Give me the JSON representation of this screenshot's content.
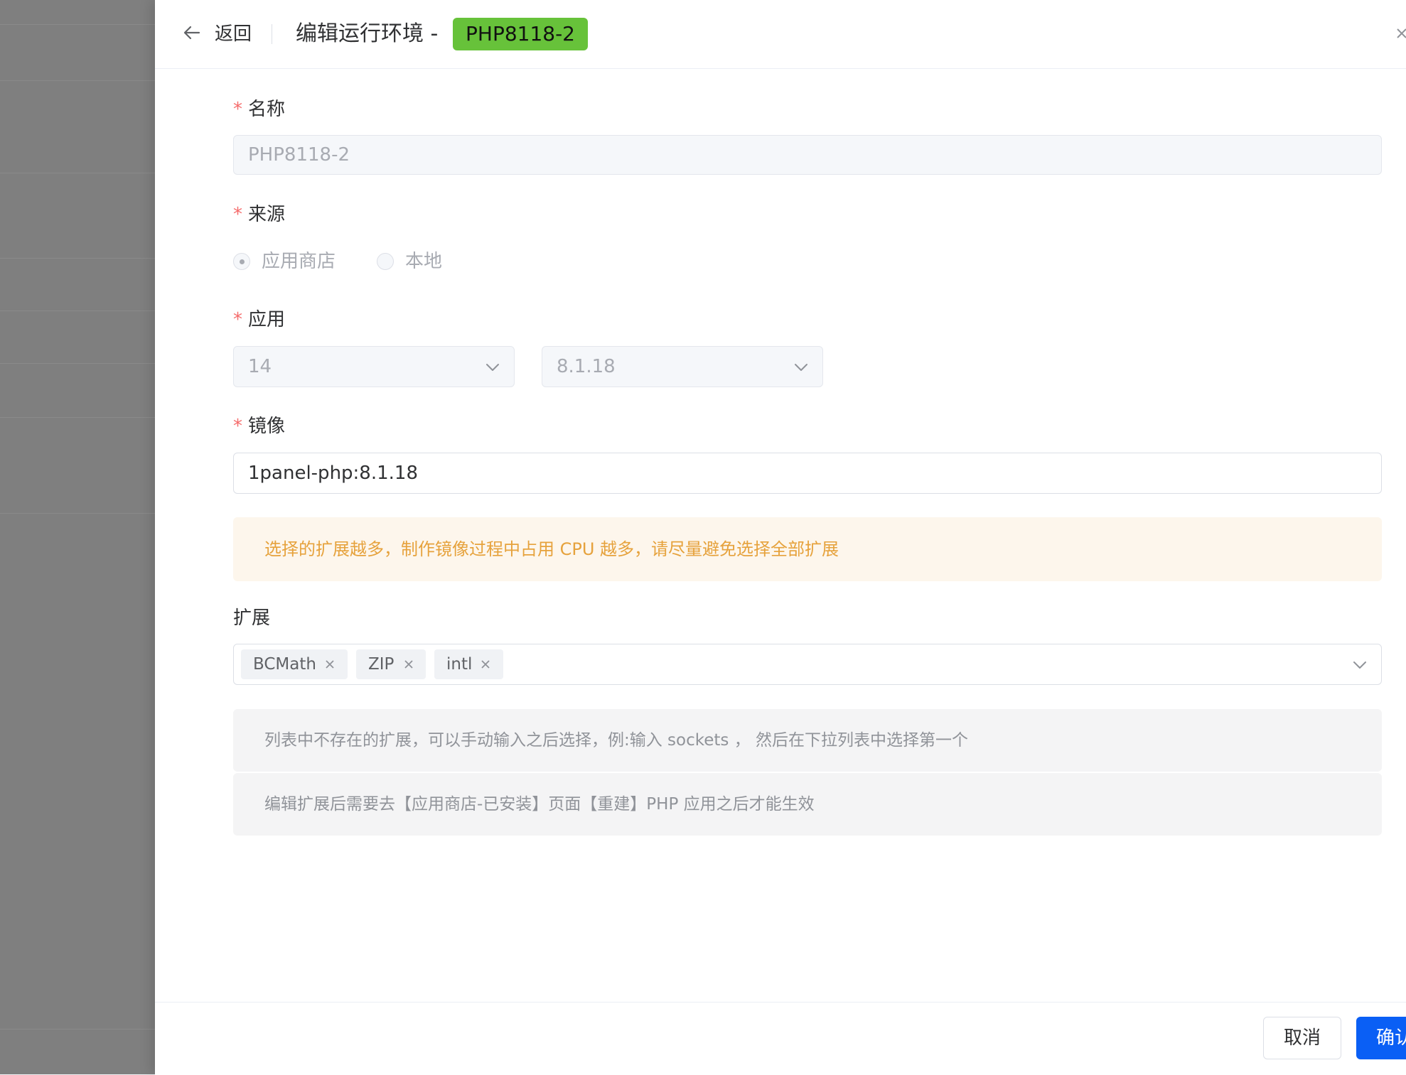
{
  "header": {
    "back_label": "返回",
    "title": "编辑运行环境 -",
    "tag": "PHP8118-2"
  },
  "form": {
    "name": {
      "label": "名称",
      "value": "PHP8118-2"
    },
    "source": {
      "label": "来源",
      "options": [
        "应用商店",
        "本地"
      ],
      "selected": "应用商店"
    },
    "app": {
      "label": "应用",
      "app_select": "14",
      "version_select": "8.1.18"
    },
    "image": {
      "label": "镜像",
      "value": "1panel-php:8.1.18"
    },
    "alert": "选择的扩展越多，制作镜像过程中占用 CPU 越多，请尽量避免选择全部扩展",
    "extensions": {
      "label": "扩展",
      "selected": [
        "BCMath",
        "ZIP",
        "intl"
      ],
      "hint_1": "列表中不存在的扩展，可以手动输入之后选择，例:输入 sockets ， 然后在下拉列表中选择第一个",
      "hint_2": "编辑扩展后需要去【应用商店-已安装】页面【重建】PHP 应用之后才能生效"
    }
  },
  "footer": {
    "cancel_label": "取消",
    "confirm_label": "确认"
  },
  "colors": {
    "primary": "#0a5ff5",
    "tag_green": "#67c23a",
    "required": "#f56c6c",
    "warning_text": "#e6a23c",
    "warning_bg": "#fdf6ec"
  },
  "icons": {
    "back": "arrow-left-icon",
    "close": "close-icon",
    "dropdown": "chevron-down-icon",
    "remove_tag": "close-icon"
  }
}
